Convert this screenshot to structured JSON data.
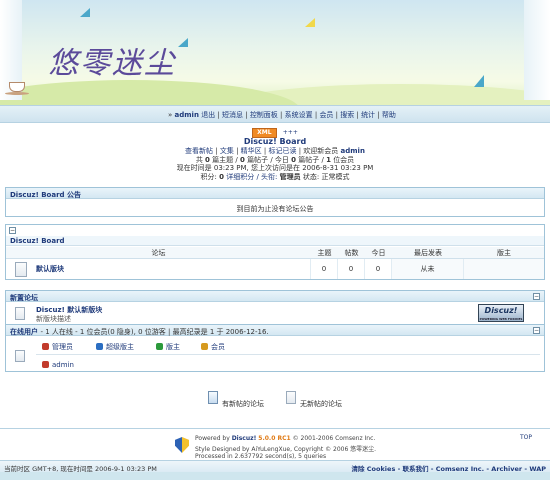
{
  "banner": {
    "logo_text": "悠零迷尘"
  },
  "nav": {
    "prefix": "»",
    "username": "admin",
    "items": [
      "退出",
      "短消息",
      "控制面板",
      "系统设置",
      "会员",
      "搜索",
      "统计",
      "帮助"
    ]
  },
  "board": {
    "xml_badge": "XML",
    "arrows": "+++",
    "name": "Discuz! Board",
    "links": [
      "查看新帖",
      "文集",
      "精华区",
      "标记已读"
    ],
    "welcome_prefix": "欢迎新会员",
    "new_member": "admin",
    "stats_line": [
      "共",
      "0",
      "篇主题 /",
      "0",
      "篇帖子 / 今日",
      "0",
      "篇帖子 /",
      "1",
      "位会员"
    ],
    "time_line": "现在时间是 03:23 PM, 您上次访问是在 2006-8-31 03:23 PM",
    "credits_line_pre": "积分:",
    "credits_value": "0",
    "credits_mid": "详细积分 / 头衔:",
    "title_value": "管理员",
    "status_line": "状态: 正常模式"
  },
  "announce": {
    "title": "Discuz! Board 公告",
    "body": "到目前为止没有论坛公告"
  },
  "forumlist": {
    "collapse": "−",
    "category": "Discuz! Board",
    "headers": [
      "论坛",
      "主题",
      "帖数",
      "今日",
      "最后发表",
      "版主"
    ],
    "row": {
      "name": "默认版块",
      "topics": "0",
      "posts": "0",
      "today": "0",
      "lastpost": "从未",
      "moderator": ""
    }
  },
  "newforums": {
    "title": "新置论坛",
    "forum_name": "Discuz! 默认新版块",
    "forum_desc": "新版块描述",
    "logo": "Discuz!",
    "logo_small": "POWERING WEB FORUMS"
  },
  "online": {
    "title": "在线用户",
    "summary": "- 1 人在线 - 1 位会员(0 隐身), 0 位游客 | 最高纪录是 1 于 2006-12-16.",
    "groups": [
      {
        "label": "管理员",
        "color": "#c23b2b"
      },
      {
        "label": "超级版主",
        "color": "#2b6ec2"
      },
      {
        "label": "版主",
        "color": "#2b9a3b"
      },
      {
        "label": "会员",
        "color": "#d69a1e"
      }
    ],
    "users": [
      "admin"
    ]
  },
  "legend": {
    "new": "有新帖的论坛",
    "nonew": "无新帖的论坛"
  },
  "footer": {
    "powered_pre": "Powered by",
    "product": "Discuz!",
    "version": "5.0.0 RC1",
    "copyright": "© 2001-2006 Comsenz Inc.",
    "style_line": "Style Designed by AiYuLengXue, Copyright © 2006 悠零迷尘.",
    "processed": "Processed in 2.637792 second(s), 5 queries",
    "top": "TOP",
    "timezone": "当前时区 GMT+8, 现在时间是 2006-9-1 03:23 PM",
    "links": "清除 Cookies - 联系我们 - Comsenz Inc. - Archiver - WAP"
  },
  "colors": {
    "link": "#1f3a7a",
    "accent": "#f08a24",
    "border": "#9fc3d8"
  }
}
